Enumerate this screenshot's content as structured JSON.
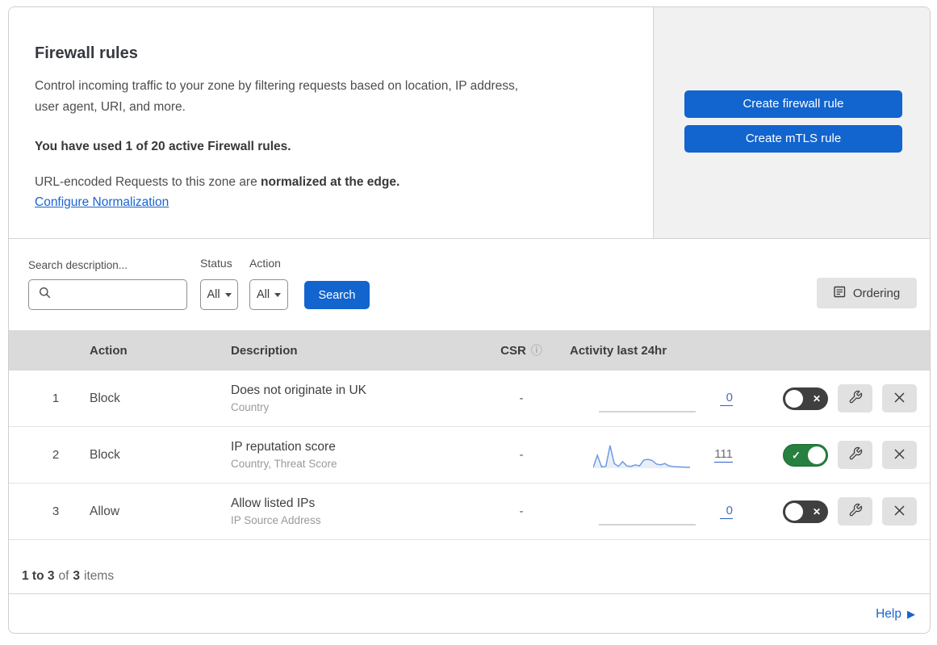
{
  "header": {
    "title": "Firewall rules",
    "description_line1": "Control incoming traffic to your zone by filtering requests based on location, IP address,",
    "description_line2": "user agent, URI, and more.",
    "usage_bold": "You have used 1 of 20 active Firewall rules.",
    "normalization_prefix": "URL-encoded Requests to this zone are ",
    "normalization_bold": "normalized at the edge.",
    "normalization_link": "Configure Normalization"
  },
  "actions_panel": {
    "create_firewall_rule": "Create firewall rule",
    "create_mtls_rule": "Create mTLS rule"
  },
  "filters": {
    "search_label": "Search description...",
    "status_label": "Status",
    "status_value": "All",
    "action_label": "Action",
    "action_value": "All",
    "search_button": "Search",
    "ordering_button": "Ordering"
  },
  "table": {
    "headers": {
      "action": "Action",
      "description": "Description",
      "csr": "CSR",
      "activity": "Activity last 24hr"
    },
    "rows": [
      {
        "number": "1",
        "action": "Block",
        "description": "Does not originate in UK",
        "criteria": "Country",
        "csr": "-",
        "count": "0",
        "count_color": "#4c70ae",
        "enabled": false,
        "activity": [
          0,
          0,
          0,
          0,
          0,
          0,
          0,
          0,
          0,
          0,
          0,
          0,
          0,
          0,
          0,
          0,
          0,
          0,
          0,
          0,
          0,
          0,
          0,
          0
        ]
      },
      {
        "number": "2",
        "action": "Block",
        "description": "IP reputation score",
        "criteria": "Country, Threat Score",
        "csr": "-",
        "count": "111",
        "count_color": "#6e6e6e",
        "enabled": true,
        "activity": [
          3,
          55,
          6,
          8,
          97,
          20,
          8,
          28,
          10,
          8,
          14,
          10,
          35,
          38,
          33,
          18,
          14,
          20,
          10,
          7,
          6,
          5,
          4,
          4
        ]
      },
      {
        "number": "3",
        "action": "Allow",
        "description": "Allow listed IPs",
        "criteria": "IP Source Address",
        "csr": "-",
        "count": "0",
        "count_color": "#4c70ae",
        "enabled": false,
        "activity": [
          0,
          0,
          0,
          0,
          0,
          0,
          0,
          0,
          0,
          0,
          0,
          0,
          0,
          0,
          0,
          0,
          0,
          0,
          0,
          0,
          0,
          0,
          0,
          0
        ]
      }
    ]
  },
  "footer": {
    "range_bold": "1 to 3",
    "of_text": "of",
    "total_bold": "3",
    "items_text": "items"
  },
  "help_link": "Help",
  "toggle": {
    "on_glyph": "✓",
    "off_glyph": "✕"
  },
  "colors": {
    "primary_button": "#1264ce",
    "link": "#1963d2",
    "toggle_on": "#26803f",
    "toggle_off": "#3f3f3f",
    "sparkline_line": "#6f9be3",
    "sparkline_fill": "#e9eff9",
    "sparkline_flat": "#b9b9b9",
    "count_underline": "#2c5fc4"
  }
}
